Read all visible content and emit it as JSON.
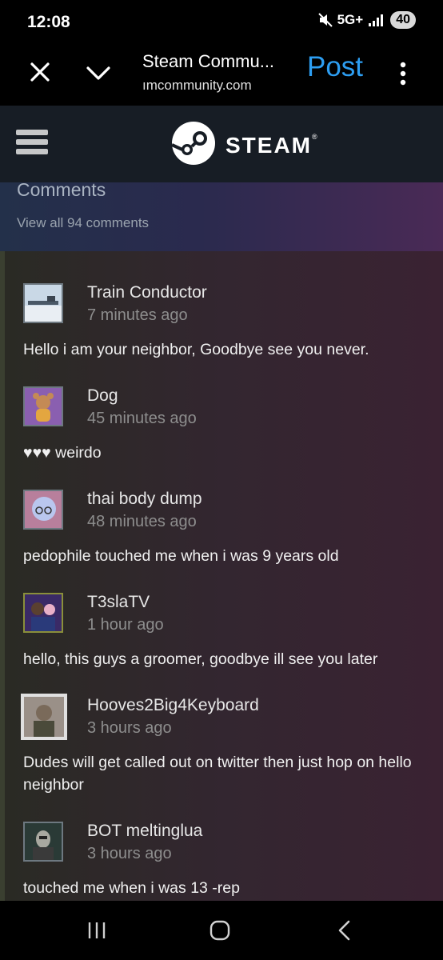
{
  "status_bar": {
    "time": "12:08",
    "network": "5G+",
    "battery": "40"
  },
  "browser_bar": {
    "title": "Steam Commu...",
    "url": "ımcommunity.com",
    "post_label": "Post"
  },
  "steam_header": {
    "brand": "STEAM",
    "trademark": "®"
  },
  "comments": {
    "heading": "Comments",
    "view_all": "View all 94 comments",
    "items": [
      {
        "author": "Train Conductor",
        "time": "7 minutes ago",
        "text": "Hello i am your neighbor, Goodbye see you never."
      },
      {
        "author": "Dog",
        "time": "45 minutes ago",
        "text": "♥♥♥ weirdo"
      },
      {
        "author": "thai body dump",
        "time": "48 minutes ago",
        "text": "pedophile touched me when i was 9 years old"
      },
      {
        "author": "T3slaTV",
        "time": "1 hour ago",
        "text": "hello, this guys a groomer, goodbye ill see you later"
      },
      {
        "author": "Hooves2Big4Keyboard",
        "time": "3 hours ago",
        "text": "Dudes will get called out on twitter then just hop on hello neighbor"
      },
      {
        "author": "BOT meltinglua",
        "time": "3 hours ago",
        "text": "touched me when i was 13 -rep"
      }
    ]
  },
  "colors": {
    "accent": "#2d9ef2",
    "steam_nav_bg": "#171d25",
    "timestamp": "#8d8d8d"
  }
}
